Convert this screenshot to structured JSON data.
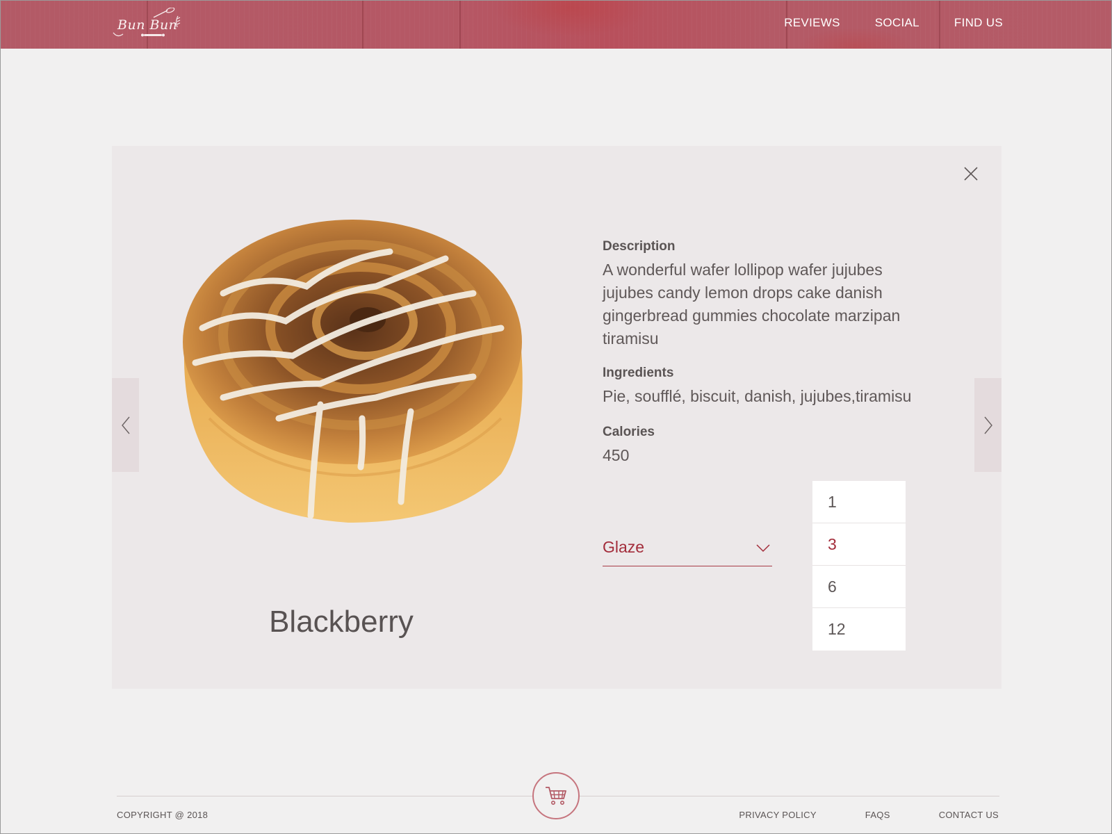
{
  "header": {
    "logo_text": "Bun Bun",
    "nav": [
      "REVIEWS",
      "SOCIAL",
      "FIND US"
    ]
  },
  "product": {
    "name": "Blackberry",
    "description_label": "Description",
    "description": "A wonderful wafer lollipop wafer jujubes jujubes candy lemon drops cake danish gingerbread gummies chocolate marzipan tiramisu",
    "ingredients_label": "Ingredients",
    "ingredients": "Pie, soufflé, biscuit, danish, jujubes,tiramisu",
    "calories_label": "Calories",
    "calories": "450"
  },
  "options": {
    "glaze_selected": "Glaze",
    "quantities": [
      "1",
      "3",
      "6",
      "12"
    ],
    "quantity_selected": "3"
  },
  "footer": {
    "copyright": "COPYRIGHT @ 2018",
    "links": [
      "PRIVACY POLICY",
      "FAQS",
      "CONTACT US"
    ]
  },
  "colors": {
    "accent": "#a32d3b",
    "header_bg": "#b55865",
    "modal_bg": "#ece8e9",
    "page_bg": "#f1f0f0"
  },
  "icons": [
    "logo-whisk-icon",
    "close-icon",
    "chevron-left-icon",
    "chevron-right-icon",
    "chevron-down-icon",
    "cart-icon"
  ]
}
